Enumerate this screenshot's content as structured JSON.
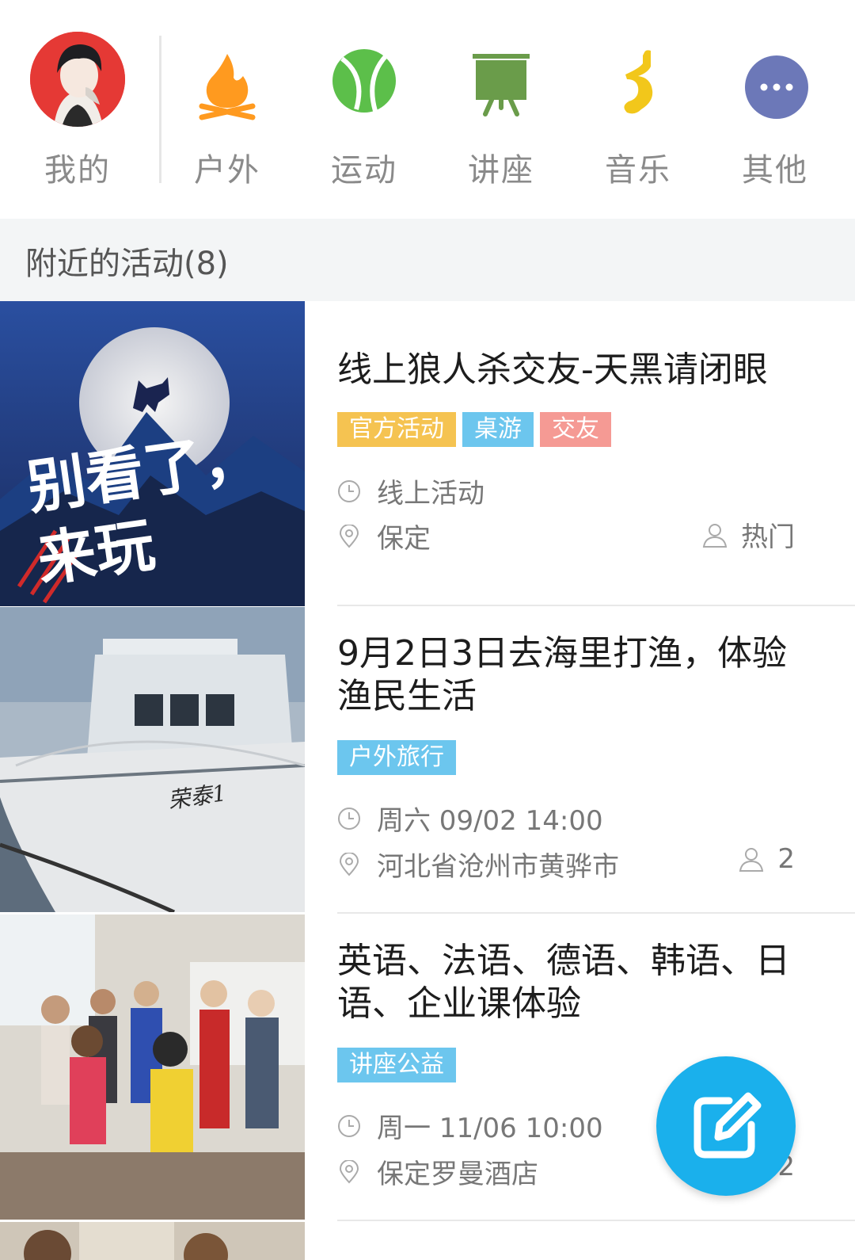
{
  "categories": [
    {
      "label": "我的",
      "icon": "avatar"
    },
    {
      "label": "户外",
      "icon": "campfire-icon",
      "color": "#ff9a1f"
    },
    {
      "label": "运动",
      "icon": "tennis-ball-icon",
      "color": "#5cbf4a"
    },
    {
      "label": "讲座",
      "icon": "presentation-board-icon",
      "color": "#6a9c4a"
    },
    {
      "label": "音乐",
      "icon": "music-note-icon",
      "color": "#f2c71b"
    },
    {
      "label": "其他",
      "icon": "more-dots-icon",
      "color": "#6c78b8"
    }
  ],
  "section": {
    "title": "附近的活动(8)"
  },
  "events": [
    {
      "title": "线上狼人杀交友-天黑请闭眼",
      "tags": [
        {
          "label": "官方活动",
          "color": "#f5c351"
        },
        {
          "label": "桌游",
          "color": "#6cc6ee"
        },
        {
          "label": "交友",
          "color": "#f59a94"
        }
      ],
      "time": "线上活动",
      "location": "保定",
      "count": "热门",
      "image_text": "别看了，来玩"
    },
    {
      "title": "9月2日3日去海里打渔，体验渔民生活",
      "tags": [
        {
          "label": "户外旅行",
          "color": "#6cc6ee"
        }
      ],
      "time": "周六 09/02 14:00",
      "location": "河北省沧州市黄骅市",
      "count": "2",
      "image_text": "荣泰1"
    },
    {
      "title": "英语、法语、德语、韩语、日语、企业课体验",
      "tags": [
        {
          "label": "讲座公益",
          "color": "#6cc6ee"
        }
      ],
      "time": "周一 11/06 10:00",
      "location": "保定罗曼酒店",
      "count": "2"
    }
  ],
  "fab": {
    "icon": "edit-icon",
    "color": "#1ab0ec"
  }
}
